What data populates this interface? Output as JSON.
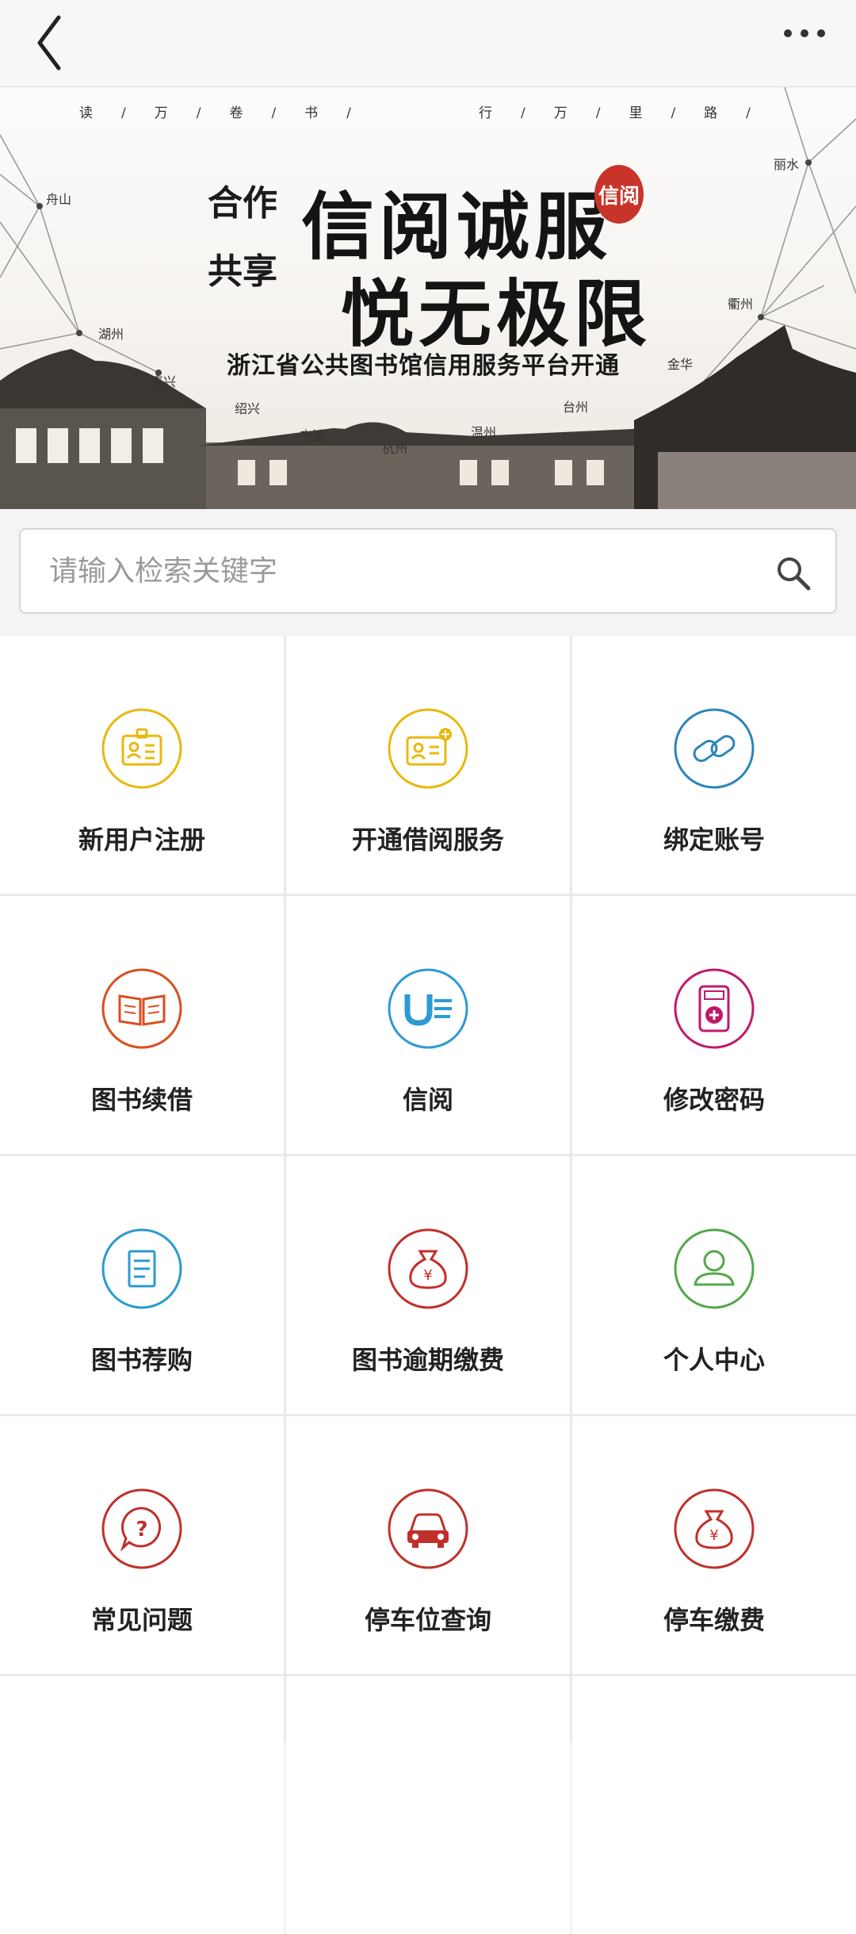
{
  "banner": {
    "slogan_left": "读/万/卷/书/",
    "slogan_right": "行/万/里/路/",
    "coop_line1": "合作",
    "coop_line2": "共享",
    "title_line1": "信阅诚服",
    "title_line2": "悦无极限",
    "seal": "信阅",
    "subline": "浙江省公共图书馆信用服务平台开通",
    "cities": [
      "舟山",
      "湖州",
      "嘉兴",
      "绍兴",
      "宁波",
      "杭州",
      "温州",
      "台州",
      "金华",
      "衢州",
      "丽水"
    ]
  },
  "search": {
    "placeholder": "请输入检索关键字"
  },
  "menu": [
    {
      "label": "新用户注册",
      "icon": "id-card-icon",
      "color": "#e8b90e"
    },
    {
      "label": "开通借阅服务",
      "icon": "id-card-star-icon",
      "color": "#e8b90e"
    },
    {
      "label": "绑定账号",
      "icon": "link-icon",
      "color": "#2b86b8"
    },
    {
      "label": "图书续借",
      "icon": "open-book-icon",
      "color": "#d94f1f"
    },
    {
      "label": "信阅",
      "icon": "u-read-icon",
      "color": "#2d9ad3"
    },
    {
      "label": "修改密码",
      "icon": "keypad-icon",
      "color": "#c01a6a"
    },
    {
      "label": "图书荐购",
      "icon": "document-icon",
      "color": "#2a9bd0"
    },
    {
      "label": "图书逾期缴费",
      "icon": "money-bag-icon",
      "color": "#c0302b"
    },
    {
      "label": "个人中心",
      "icon": "user-icon",
      "color": "#52a84a"
    },
    {
      "label": "常见问题",
      "icon": "question-bubble-icon",
      "color": "#c0302b"
    },
    {
      "label": "停车位查询",
      "icon": "car-icon",
      "color": "#c0302b"
    },
    {
      "label": "停车缴费",
      "icon": "money-bag-icon",
      "color": "#c0302b"
    }
  ]
}
